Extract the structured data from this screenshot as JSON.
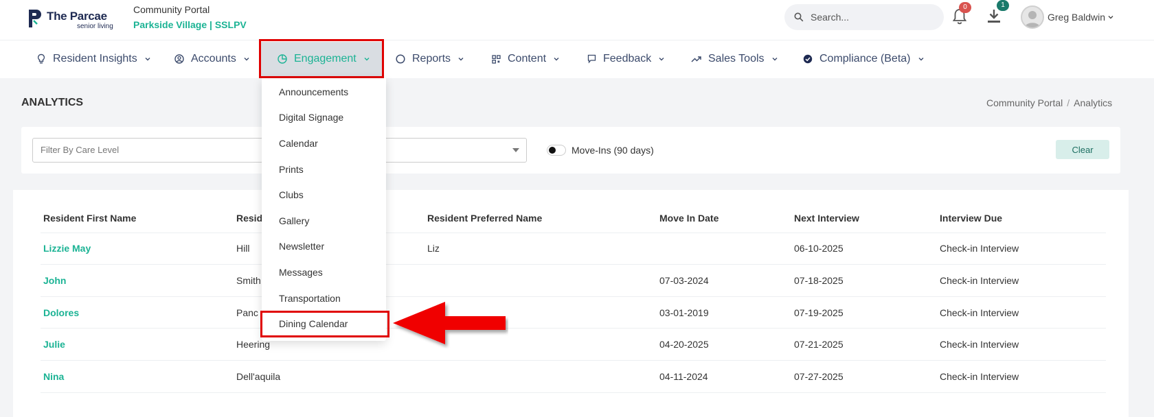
{
  "header": {
    "brand": {
      "name": "The Parcae",
      "tagline": "senior living"
    },
    "portal_title": "Community Portal",
    "portal_subtitle": "Parkside Village | SSLPV",
    "search": {
      "placeholder": "Search..."
    },
    "notifications": {
      "count": "0"
    },
    "downloads": {
      "count": "1"
    },
    "user": {
      "name": "Greg Baldwin"
    }
  },
  "nav": {
    "items": [
      {
        "label": "Resident Insights",
        "icon": "lightbulb-icon"
      },
      {
        "label": "Accounts",
        "icon": "user-circle-icon"
      },
      {
        "label": "Engagement",
        "icon": "pie-chart-icon",
        "active": true
      },
      {
        "label": "Reports",
        "icon": "circle-icon"
      },
      {
        "label": "Content",
        "icon": "grid-icon"
      },
      {
        "label": "Feedback",
        "icon": "chat-icon"
      },
      {
        "label": "Sales Tools",
        "icon": "trend-up-icon"
      },
      {
        "label": "Compliance (Beta)",
        "icon": "check-badge-icon"
      }
    ]
  },
  "engagement_menu": {
    "items": [
      "Announcements",
      "Digital Signage",
      "Calendar",
      "Prints",
      "Clubs",
      "Gallery",
      "Newsletter",
      "Messages",
      "Transportation",
      "Dining Calendar"
    ],
    "highlighted": "Dining Calendar"
  },
  "page": {
    "title": "ANALYTICS",
    "breadcrumb": [
      "Community Portal",
      "Analytics"
    ]
  },
  "filters": {
    "care_level_placeholder": "Filter By Care Level",
    "move_ins_label": "Move-Ins (90 days)",
    "move_ins_enabled": false,
    "clear_label": "Clear"
  },
  "table": {
    "columns": [
      "Resident First Name",
      "Resid",
      "Resident Preferred Name",
      "Move In Date",
      "Next Interview",
      "Interview Due"
    ],
    "rows": [
      {
        "first_name": "Lizzie May",
        "last_name": "Hill",
        "preferred": "Liz",
        "move_in": "",
        "next_interview": "06-10-2025",
        "due": "Check-in Interview"
      },
      {
        "first_name": "John",
        "last_name": "Smith",
        "preferred": "",
        "move_in": "07-03-2024",
        "next_interview": "07-18-2025",
        "due": "Check-in Interview"
      },
      {
        "first_name": "Dolores",
        "last_name": "Panc",
        "preferred": "",
        "move_in": "03-01-2019",
        "next_interview": "07-19-2025",
        "due": "Check-in Interview"
      },
      {
        "first_name": "Julie",
        "last_name": "Heering",
        "preferred": "",
        "move_in": "04-20-2025",
        "next_interview": "07-21-2025",
        "due": "Check-in Interview"
      },
      {
        "first_name": "Nina",
        "last_name": "Dell'aquila",
        "preferred": "",
        "move_in": "04-11-2024",
        "next_interview": "07-27-2025",
        "due": "Check-in Interview"
      }
    ]
  },
  "colors": {
    "accent": "#1bb394",
    "nav_text": "#3b4a6b",
    "annotation_red": "#e00000"
  }
}
